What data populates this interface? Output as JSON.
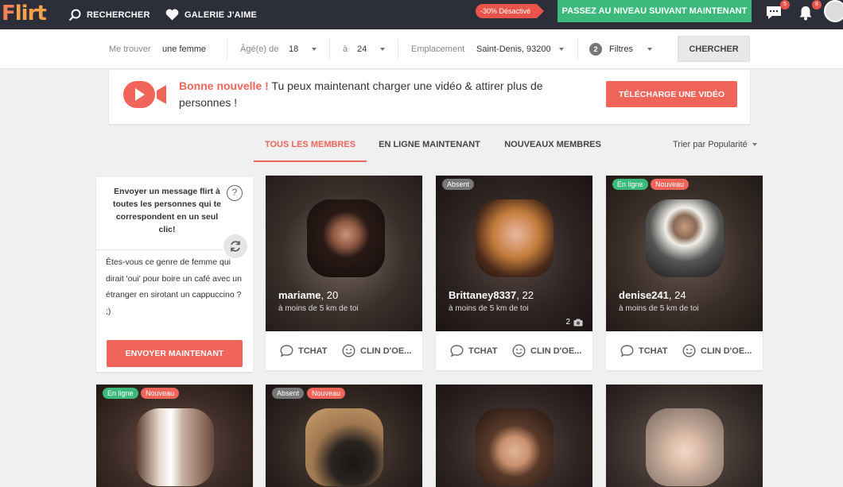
{
  "topbar": {
    "logo_prefix": "F",
    "logo_rest": "lirt",
    "nav_search": "RECHERCHER",
    "nav_gallery": "GALERIE J'AIME",
    "promo": "-30% Désactivé",
    "upgrade": "PASSEZ AU NIVEAU SUIVANT MAINTENANT",
    "messages_badge": "5",
    "notifications_badge": "8"
  },
  "filters": {
    "find_label": "Me trouver",
    "find_value": "une femme",
    "age_label": "Âgé(e) de",
    "age_from": "18",
    "age_to_label": "à",
    "age_to": "24",
    "location_label": "Emplacement",
    "location_value": "Saint-Denis, 93200",
    "filter_count": "2",
    "filters_label": "Filtres",
    "search_button": "CHERCHER"
  },
  "banner": {
    "highlight": "Bonne nouvelle !",
    "text": "Tu peux maintenant charger une vidéo & attirer plus de personnes !",
    "button": "TÉLÉCHARGE UNE VIDÉO"
  },
  "tabs": [
    {
      "label": "TOUS LES MEMBRES",
      "active": true
    },
    {
      "label": "EN LIGNE MAINTENANT",
      "active": false
    },
    {
      "label": "NOUVEAUX MEMBRES",
      "active": false
    }
  ],
  "sort_label": "Trier par Popularité",
  "flirt": {
    "title": "Envoyer un message flirt à toutes les personnes qui te correspondent en un seul clic!",
    "help": "?",
    "message": "Êtes-vous ce genre de femme qui dirait 'oui' pour boire un café avec un étranger en sirotant un cappuccino ? ;)",
    "button": "ENVOYER MAINTENANT"
  },
  "member_actions": {
    "chat": "TCHAT",
    "wink": "CLIN D'OE..."
  },
  "members": [
    {
      "name": "mariame",
      "age": ", 20",
      "distance": "à moins de 5 km de toi",
      "photos": "",
      "status": []
    },
    {
      "name": "Brittaney8337",
      "age": ", 22",
      "distance": "à moins de 5 km de toi",
      "photos": "2",
      "status": [
        "Absent"
      ]
    },
    {
      "name": "denise241",
      "age": ", 24",
      "distance": "à moins de 5 km de toi",
      "photos": "",
      "status": [
        "En ligne",
        "Nouveau"
      ]
    },
    {
      "status": [
        "En ligne",
        "Nouveau"
      ]
    },
    {
      "status": [
        "Absent",
        "Nouveau"
      ]
    },
    {
      "status": []
    },
    {
      "status": []
    }
  ],
  "colors": {
    "accent": "#f0645a",
    "green": "#3cba7c",
    "topbar": "#2c2f3a"
  }
}
